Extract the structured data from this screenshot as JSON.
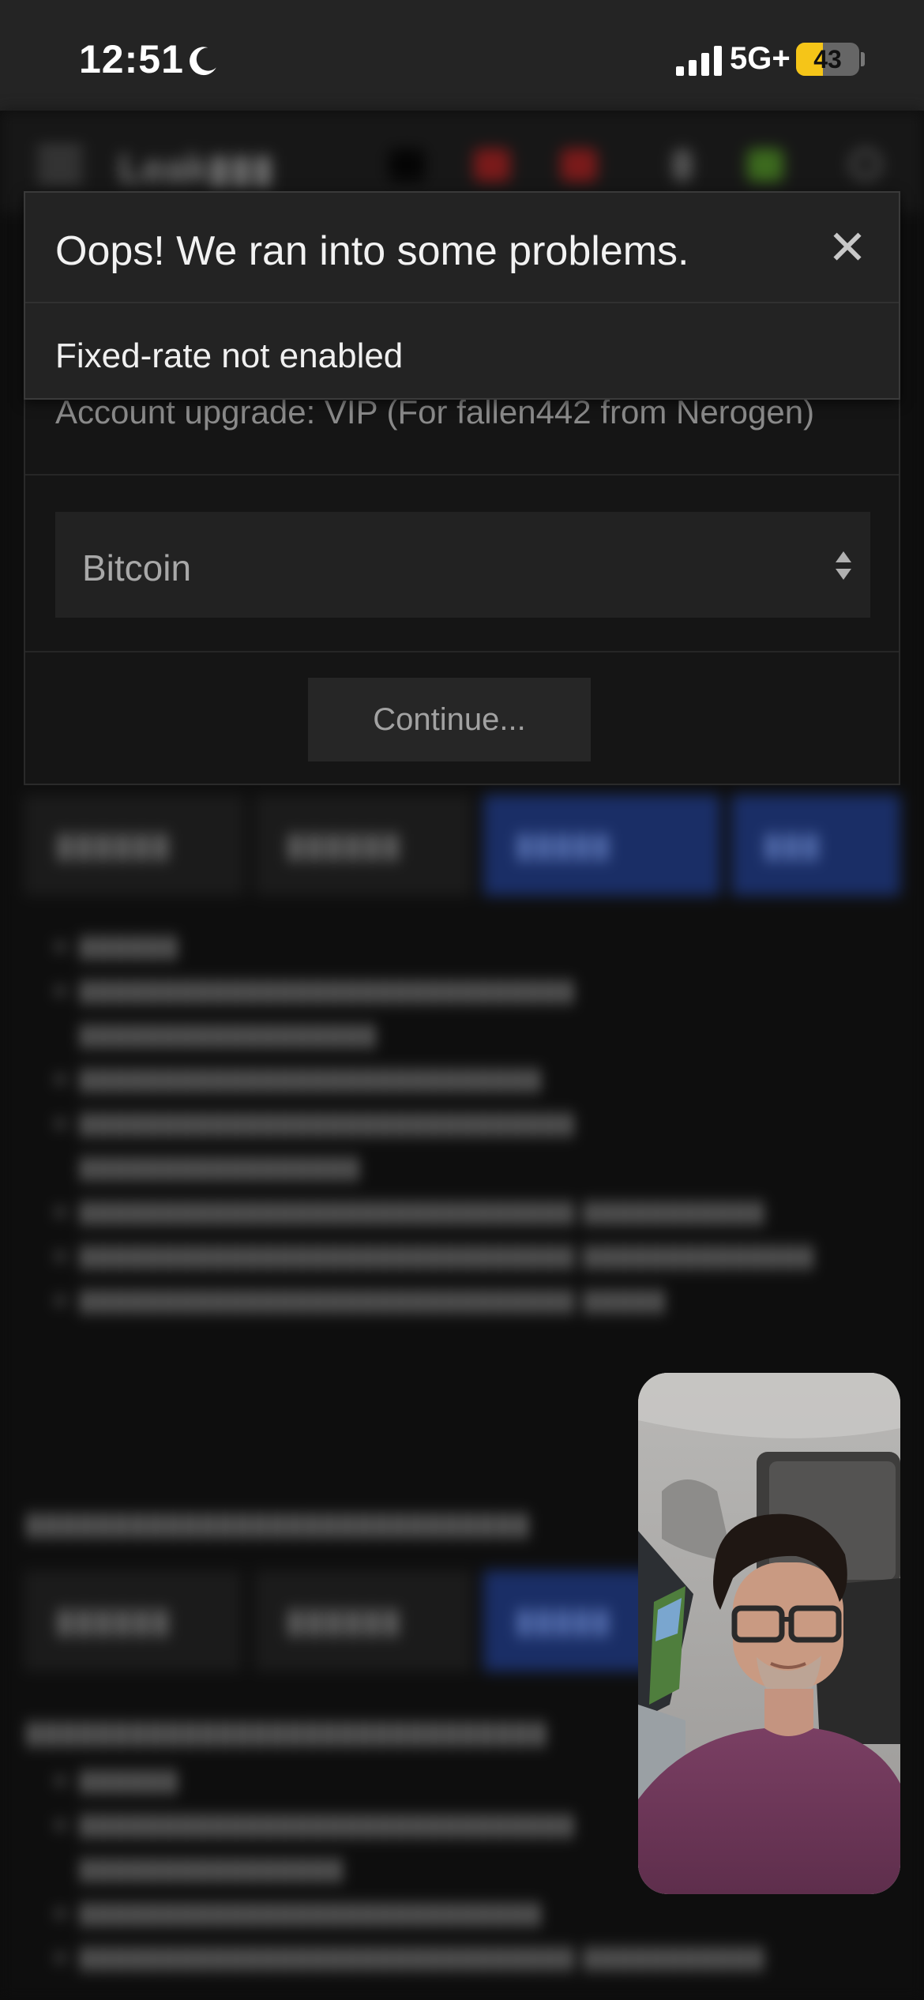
{
  "status_bar": {
    "time": "12:51",
    "moon_icon": "moon-icon",
    "signal_icon": "cellular-signal-icon",
    "network": "5G+",
    "battery": "43",
    "battery_level": 0.43,
    "battery_color": "#f5c518"
  },
  "error": {
    "title": "Oops! We ran into some problems.",
    "close_icon": "close-icon",
    "close_label": "✕",
    "message": "Fixed-rate not enabled"
  },
  "modal": {
    "description": "Account upgrade: VIP (For fallen442 from Nerogen)",
    "currency": {
      "selected": "Bitcoin",
      "icon": "select-arrows-icon"
    },
    "continue_label": "Continue..."
  },
  "video_call": {
    "type": "facetime-pip",
    "icon": "self-view-camera"
  }
}
